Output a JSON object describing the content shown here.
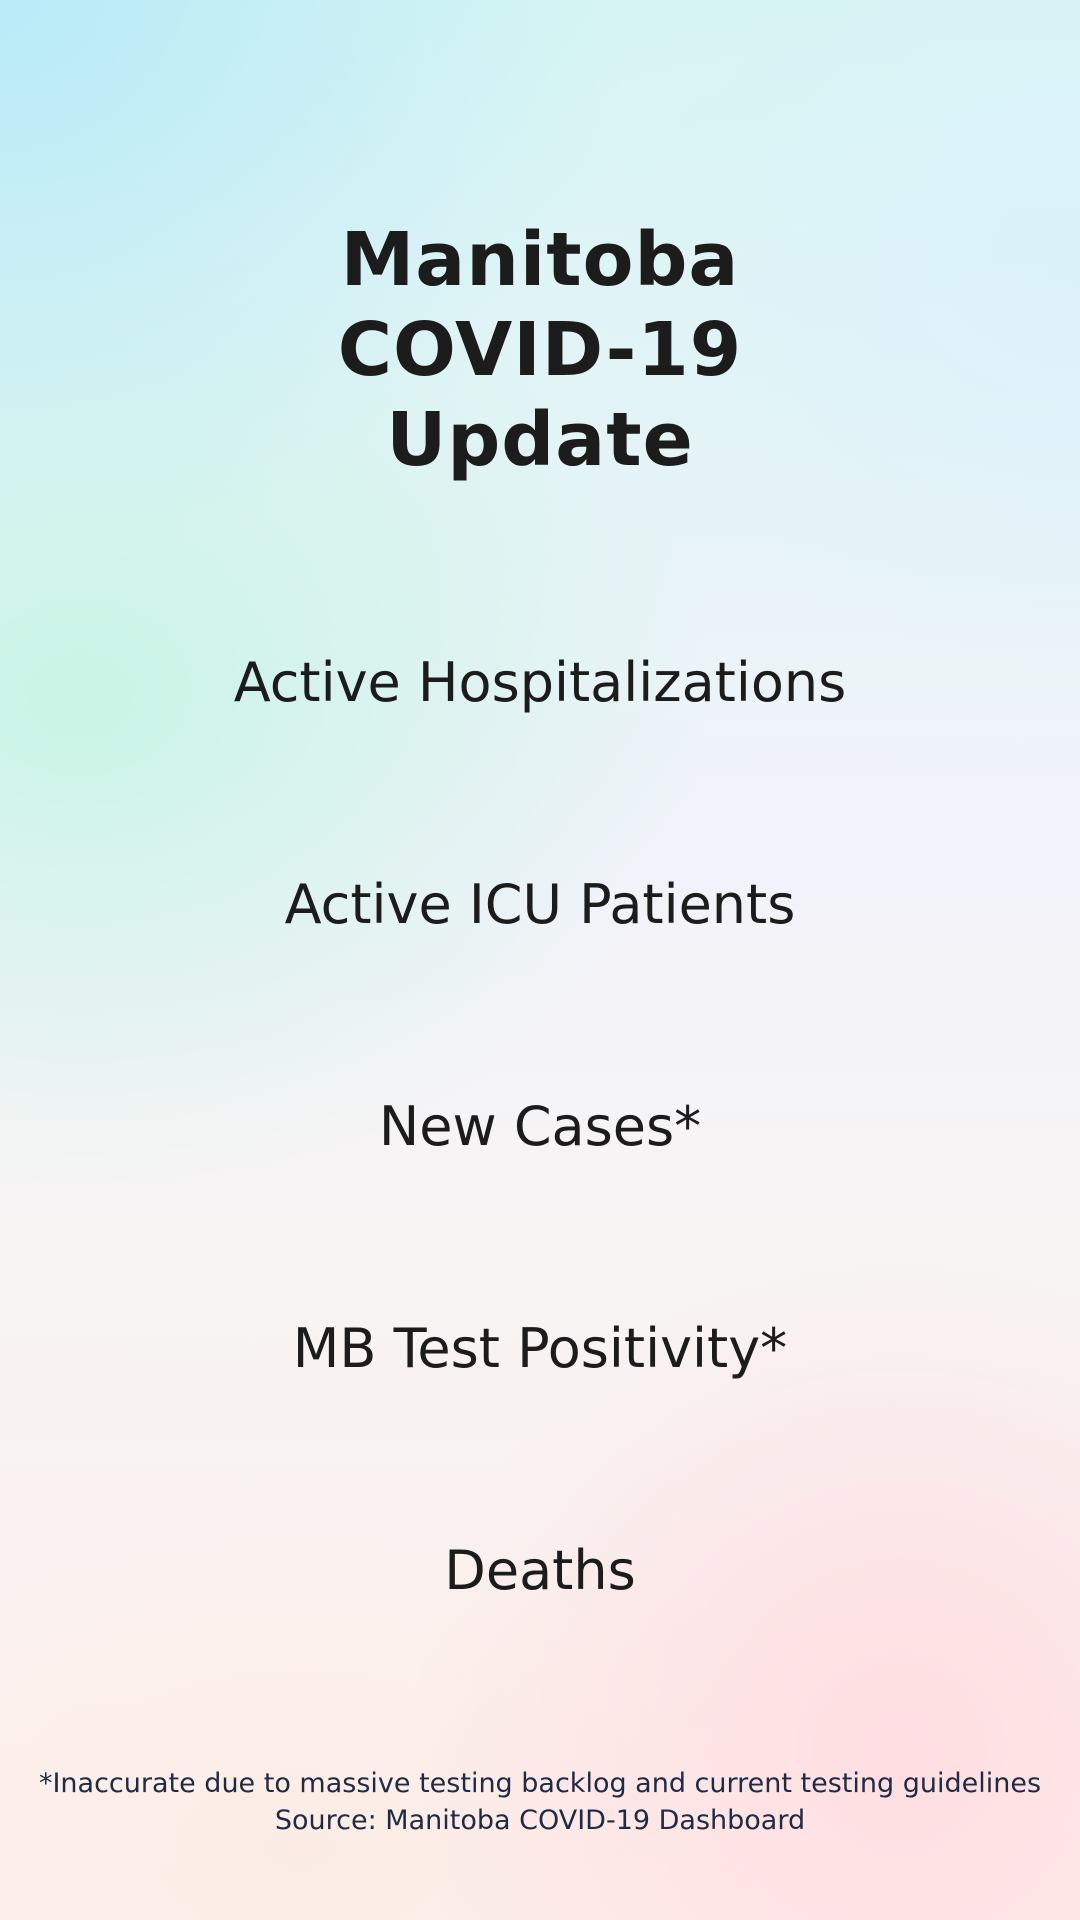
{
  "title": {
    "line1": "Manitoba",
    "line2": "COVID-19",
    "line3": "Update"
  },
  "metrics": [
    {
      "label": "Active Hospitalizations"
    },
    {
      "label": "Active ICU Patients"
    },
    {
      "label": "New Cases*"
    },
    {
      "label": "MB Test Positivity*"
    },
    {
      "label": "Deaths"
    }
  ],
  "footnote": {
    "disclaimer": "*Inaccurate due to massive testing backlog and current testing guidelines",
    "source": "Source: Manitoba COVID-19 Dashboard"
  }
}
